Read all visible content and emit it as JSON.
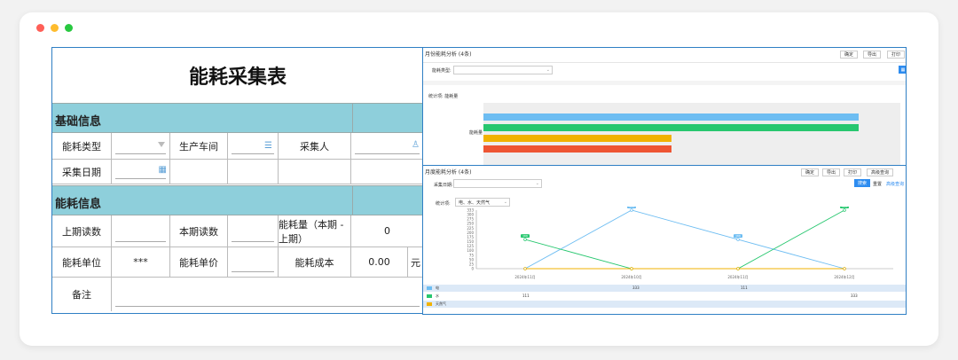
{
  "form": {
    "title": "能耗采集表",
    "section_basic": "基础信息",
    "section_energy": "能耗信息",
    "energy_type_label": "能耗类型",
    "workshop_label": "生产车间",
    "collector_label": "采集人",
    "collect_date_label": "采集日期",
    "last_reading_label": "上期读数",
    "current_reading_label": "本期读数",
    "consumption_label": "能耗量（本期 - 上期）",
    "consumption_value": "0",
    "unit_label": "能耗单位",
    "unit_value": "***",
    "unit_price_label": "能耗单价",
    "cost_label": "能耗成本",
    "cost_value": "0.00",
    "currency": "元",
    "remark_label": "备注"
  },
  "top_panel": {
    "title": "月份能耗分析 (4条)",
    "buttons": [
      "确定",
      "导出",
      "打印"
    ],
    "filter_label": "能耗类型:",
    "stat_label": "统计项: 能耗量",
    "axis_label": "能耗量",
    "bars": [
      {
        "color": "#6dbdf2",
        "value": 0.9
      },
      {
        "color": "#27c76f",
        "value": 0.9
      },
      {
        "color": "#f1b200",
        "value": 0.45
      },
      {
        "color": "#ee5533",
        "value": 0.45
      }
    ]
  },
  "bottom_panel": {
    "title": "月度能耗分析 (4条)",
    "buttons": [
      "确定",
      "导出",
      "打印",
      "高级查询"
    ],
    "date_label": "采集日期:",
    "search_btn": "搜索",
    "reset_btn": "重置",
    "adv_link": "高级查询",
    "stat_label": "统计项:",
    "stat_value": "电、水、天然气",
    "x_labels": [
      "2024年11月",
      "2024年10月",
      "2024年11月",
      "2024年12月"
    ],
    "y_labels": [
      "333",
      "300",
      "275",
      "250",
      "225",
      "200",
      "175",
      "150",
      "125",
      "100",
      "75",
      "50",
      "25",
      "0"
    ],
    "legend": [
      "电",
      "水",
      "天然气"
    ],
    "table_values": {
      "electric": [
        "",
        "333",
        "111",
        ""
      ],
      "water": [
        "111",
        "",
        "",
        "333"
      ]
    }
  },
  "chart_data": {
    "type": "line",
    "x": [
      "2024年11月",
      "2024年10月",
      "2024年11月",
      "2024年12月"
    ],
    "series": [
      {
        "name": "电",
        "values": [
          0,
          333,
          166,
          0
        ]
      },
      {
        "name": "水",
        "values": [
          166,
          0,
          0,
          333
        ]
      },
      {
        "name": "天然气",
        "values": [
          0,
          0,
          0,
          0
        ]
      }
    ],
    "ylim": [
      0,
      333
    ]
  },
  "colors": {
    "section_bg": "#8ecfdb",
    "border_blue": "#2f7fc4",
    "electric": "#6dbdf2",
    "water": "#27c76f",
    "gas": "#f1b200"
  }
}
